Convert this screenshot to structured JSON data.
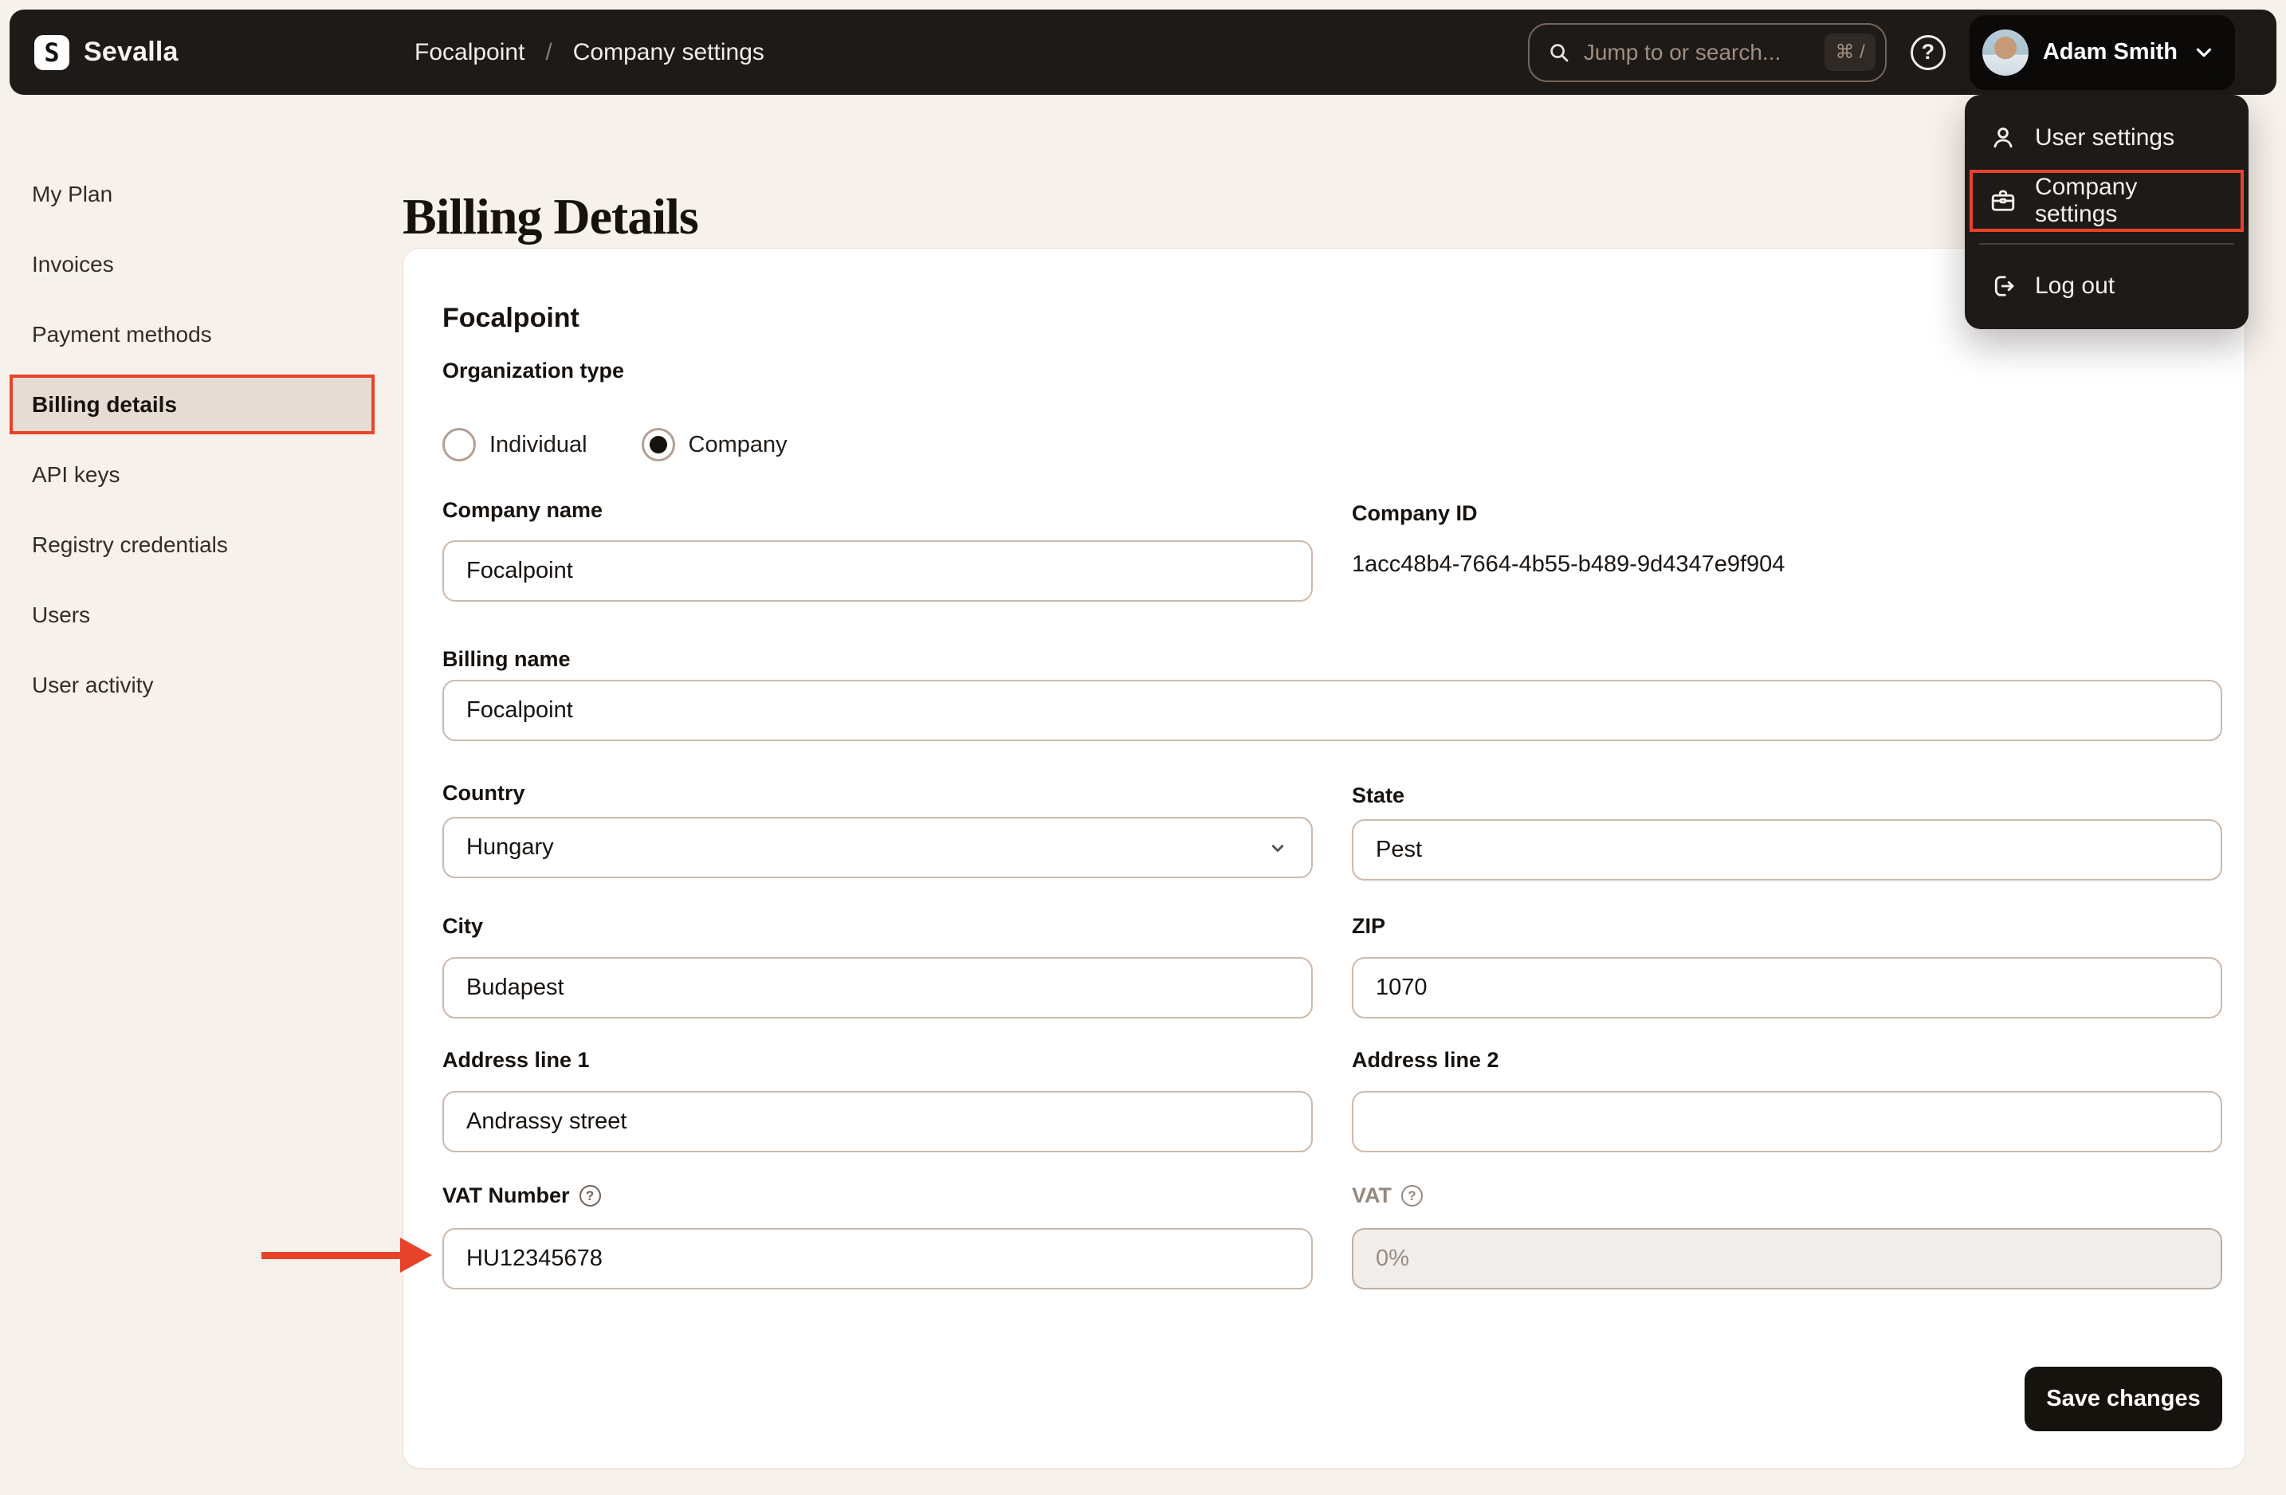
{
  "colors": {
    "accent_red": "#e8432a",
    "topbar_bg": "#1e1a17",
    "page_bg": "#f7f1ec",
    "card_bg": "#ffffff",
    "active_item_bg": "#e6dcd3"
  },
  "glyphs": {
    "help": "?",
    "logo": "S"
  },
  "topbar": {
    "brand": "Sevalla",
    "breadcrumb": {
      "items": [
        "Focalpoint",
        "Company settings"
      ],
      "separator": "/"
    },
    "search": {
      "placeholder": "Jump to or search...",
      "shortcut": "⌘ /"
    },
    "user": {
      "name": "Adam Smith"
    }
  },
  "user_menu": {
    "items": [
      {
        "label": "User settings",
        "icon": "user-icon",
        "highlighted": false
      },
      {
        "label": "Company settings",
        "icon": "briefcase-icon",
        "highlighted": true
      },
      {
        "label": "Log out",
        "icon": "logout-icon",
        "highlighted": false
      }
    ]
  },
  "sidebar": {
    "items": [
      {
        "label": "My Plan",
        "active": false
      },
      {
        "label": "Invoices",
        "active": false
      },
      {
        "label": "Payment methods",
        "active": false
      },
      {
        "label": "Billing details",
        "active": true
      },
      {
        "label": "API keys",
        "active": false
      },
      {
        "label": "Registry credentials",
        "active": false
      },
      {
        "label": "Users",
        "active": false
      },
      {
        "label": "User activity",
        "active": false
      }
    ]
  },
  "page": {
    "title": "Billing Details"
  },
  "form": {
    "heading": "Focalpoint",
    "org_type": {
      "label": "Organization type",
      "options": [
        {
          "label": "Individual",
          "selected": false
        },
        {
          "label": "Company",
          "selected": true
        }
      ]
    },
    "fields": {
      "company_name": {
        "label": "Company name",
        "value": "Focalpoint"
      },
      "company_id": {
        "label": "Company ID",
        "value": "1acc48b4-7664-4b55-b489-9d4347e9f904"
      },
      "billing_name": {
        "label": "Billing name",
        "value": "Focalpoint"
      },
      "country": {
        "label": "Country",
        "value": "Hungary"
      },
      "state": {
        "label": "State",
        "value": "Pest"
      },
      "city": {
        "label": "City",
        "value": "Budapest"
      },
      "zip": {
        "label": "ZIP",
        "value": "1070"
      },
      "address1": {
        "label": "Address line 1",
        "value": "Andrassy street"
      },
      "address2": {
        "label": "Address line 2",
        "value": ""
      },
      "vat_number": {
        "label": "VAT Number",
        "value": "HU12345678"
      },
      "vat": {
        "label": "VAT",
        "value": "0%",
        "disabled": true
      }
    },
    "save_label": "Save changes"
  }
}
